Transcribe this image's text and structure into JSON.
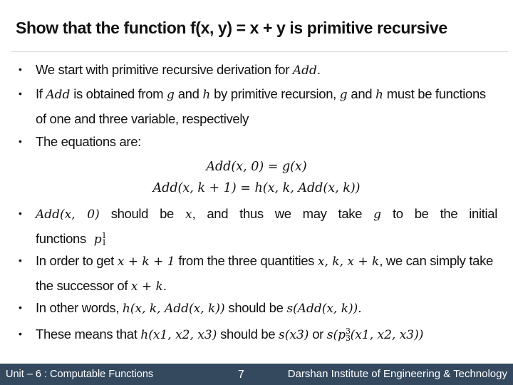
{
  "slide": {
    "title": "Show that the function f(x, y) = x + y is primitive recursive"
  },
  "bullets": [
    {
      "text_before": "We start with primitive recursive derivation for ",
      "math": "Add",
      "text_after": "."
    },
    {
      "parts": [
        "If ",
        "Add",
        " is obtained from ",
        "g",
        " and ",
        "h",
        " by primitive recursion, ",
        "g",
        " and ",
        "h",
        " must be functions of one and three variable, respectively"
      ]
    },
    {
      "text": "The equations are:"
    },
    {
      "parts": [
        "Add(x, 0)",
        " should be ",
        "x",
        ", and thus we may take ",
        "g",
        " to be the initial functions ",
        "p"
      ],
      "p_sup": "1",
      "p_sub": "1"
    },
    {
      "parts": [
        "In order to get ",
        "x + k + 1",
        " from the three quantities ",
        "x, k, x + k",
        ", we can simply take the successor of ",
        "x + k",
        "."
      ]
    },
    {
      "parts": [
        "In other words, ",
        "h(x, k, Add(x, k))",
        " should be ",
        "s(Add(x, k))",
        "."
      ]
    },
    {
      "parts": [
        "These means that ",
        "h(x1, x2, x3)",
        " should be ",
        "s(x3)",
        " or ",
        "s(",
        "p",
        "(x1, x2, x3))"
      ],
      "p_sup": "3",
      "p_sub": "3"
    }
  ],
  "equations": [
    "Add(x, 0) = g(x)",
    "Add(x, k + 1) = h(x, k, Add(x, k))"
  ],
  "bullet_glyph": "•",
  "footer": {
    "unit": "Unit – 6 : Computable Functions",
    "page": "7",
    "institute": "Darshan Institute of Engineering & Technology",
    "background": "#34495e"
  }
}
